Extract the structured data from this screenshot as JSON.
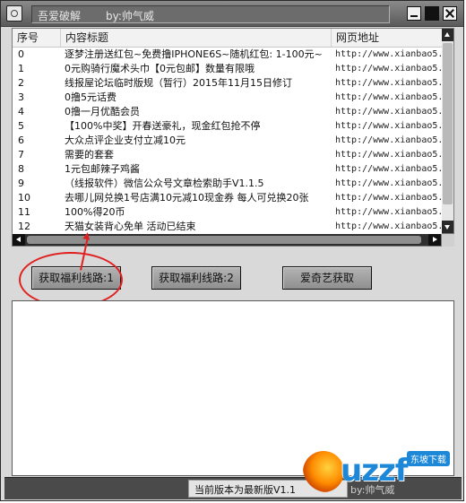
{
  "window": {
    "title": "吾爱破解",
    "author_label": "by:帅气威"
  },
  "list": {
    "columns": [
      "序号",
      "内容标题",
      "网页地址"
    ],
    "rows": [
      {
        "no": "0",
        "title": "逐梦注册送红包~免费撸IPHONE6S~随机红包: 1-100元~",
        "url": "http://www.xianbao5."
      },
      {
        "no": "1",
        "title": "0元购骑行魔术头巾【0元包邮】数量有限哦",
        "url": "http://www.xianbao5."
      },
      {
        "no": "2",
        "title": "线报屋论坛临时版规（暂行）2015年11月15日修订",
        "url": "http://www.xianbao5."
      },
      {
        "no": "3",
        "title": "0撸5元话费",
        "url": "http://www.xianbao5."
      },
      {
        "no": "4",
        "title": "0撸一月优酷会员",
        "url": "http://www.xianbao5."
      },
      {
        "no": "5",
        "title": "【100%中奖】开春送豪礼，现金红包抢不停",
        "url": "http://www.xianbao5."
      },
      {
        "no": "6",
        "title": "大众点评企业支付立减10元",
        "url": "http://www.xianbao5."
      },
      {
        "no": "7",
        "title": "需要的套套",
        "url": "http://www.xianbao5."
      },
      {
        "no": "8",
        "title": "1元包邮辣子鸡酱",
        "url": "http://www.xianbao5."
      },
      {
        "no": "9",
        "title": "（线报软件）微信公众号文章检索助手V1.1.5",
        "url": "http://www.xianbao5."
      },
      {
        "no": "10",
        "title": "去哪儿网兑换1号店满10元减10现金券 每人可兑换20张",
        "url": "http://www.xianbao5."
      },
      {
        "no": "11",
        "title": "100%得20币",
        "url": "http://www.xianbao5."
      },
      {
        "no": "12",
        "title": "天猫女装背心免单  活动已结束",
        "url": "http://www.xianbao5."
      }
    ]
  },
  "buttons": {
    "route1": "获取福利线路:1",
    "route2": "获取福利线路:2",
    "iqiyi": "爱奇艺获取"
  },
  "status": {
    "version_text": "当前版本为最新版V1.1",
    "author": "by:帅气威"
  },
  "watermark": {
    "brand": "uzzf",
    "badge": "东坡下载"
  }
}
